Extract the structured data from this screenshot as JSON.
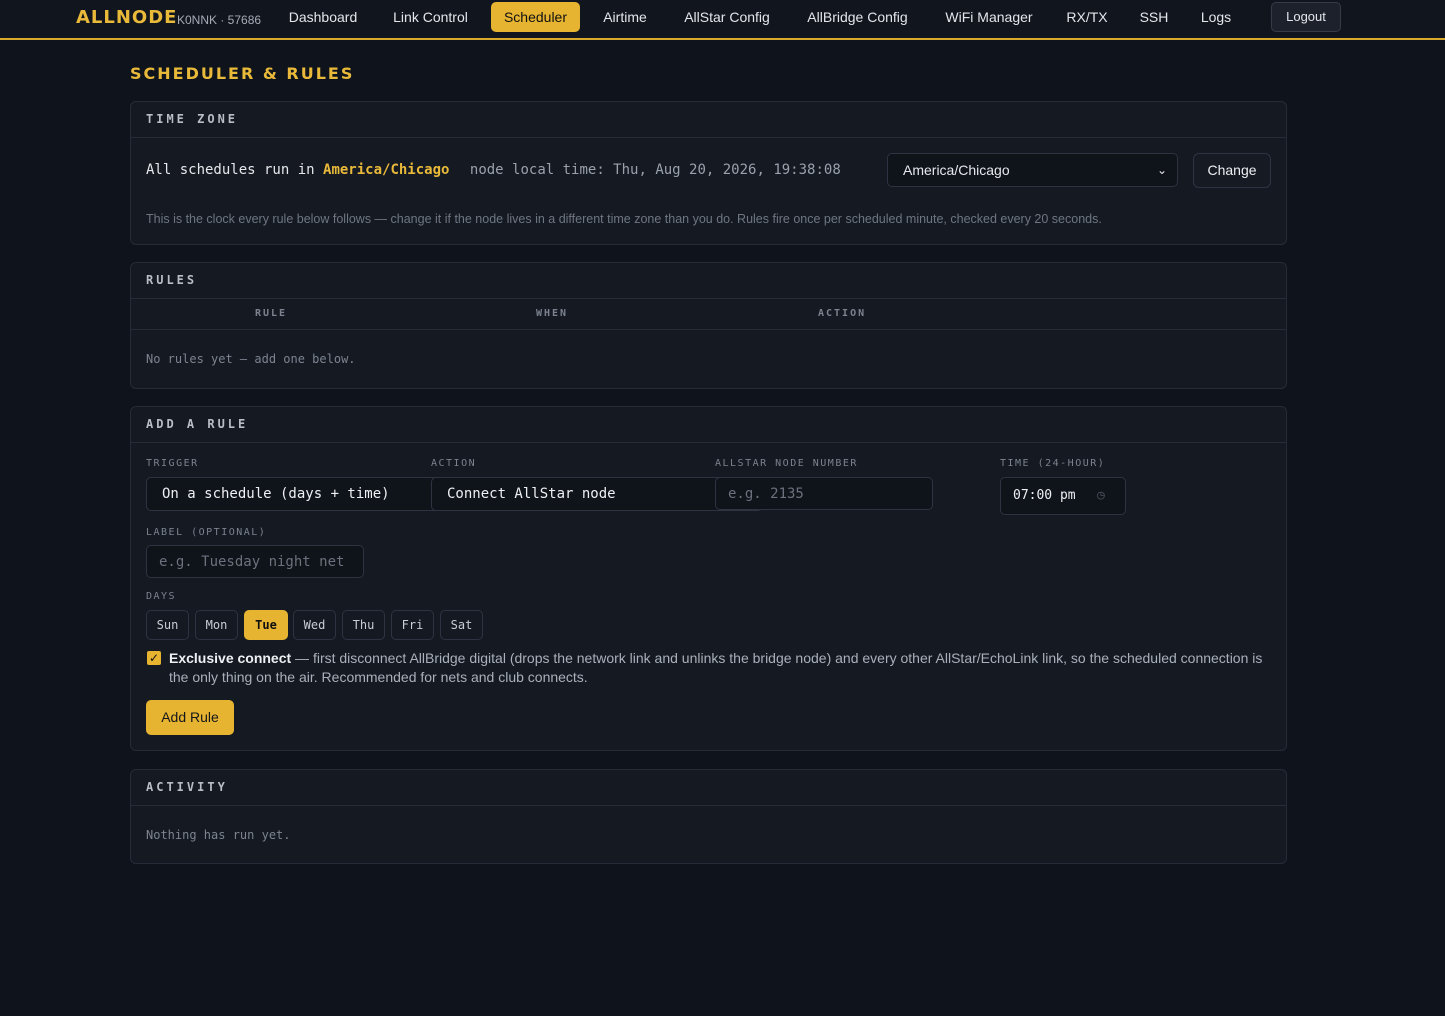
{
  "brand": {
    "name": "ALLNODE",
    "subtitle": "K0NNK · 57686"
  },
  "nav": {
    "items": [
      {
        "label": "Dashboard"
      },
      {
        "label": "Link Control"
      },
      {
        "label": "Scheduler",
        "active": true
      },
      {
        "label": "Airtime"
      },
      {
        "label": "AllStar Config"
      },
      {
        "label": "AllBridge Config"
      },
      {
        "label": "WiFi Manager"
      },
      {
        "label": "RX/TX"
      },
      {
        "label": "SSH"
      },
      {
        "label": "Logs"
      }
    ],
    "logout_label": "Logout"
  },
  "page_title": "SCHEDULER & RULES",
  "timezone": {
    "header": "TIME ZONE",
    "line_prefix": "All schedules run in",
    "city": "America/Chicago",
    "local_time": "node local time: Thu, Aug 20, 2026, 19:38:08",
    "select_value": "America/Chicago",
    "change_label": "Change",
    "hint": "This is the clock every rule below follows — change it if the node lives in a different time zone than you do. Rules fire once per scheduled minute, checked every 20 seconds."
  },
  "rules": {
    "header": "RULES",
    "columns": [
      "RULE",
      "WHEN",
      "ACTION"
    ],
    "empty": "No rules yet — add one below."
  },
  "add_rule": {
    "header": "ADD A RULE",
    "trigger_label": "TRIGGER",
    "trigger_value": "On a schedule (days + time)",
    "action_label": "ACTION",
    "action_value": "Connect AllStar node",
    "node_label": "ALLSTAR NODE NUMBER",
    "node_placeholder": "e.g. 2135",
    "time_label": "TIME (24-HOUR)",
    "time_value": "07:00 pm",
    "label_label": "LABEL (OPTIONAL)",
    "label_placeholder": "e.g. Tuesday night net",
    "days_label": "DAYS",
    "days": [
      {
        "label": "Sun",
        "selected": false
      },
      {
        "label": "Mon",
        "selected": false
      },
      {
        "label": "Tue",
        "selected": true
      },
      {
        "label": "Wed",
        "selected": false
      },
      {
        "label": "Thu",
        "selected": false
      },
      {
        "label": "Fri",
        "selected": false
      },
      {
        "label": "Sat",
        "selected": false
      }
    ],
    "exclusive_checked": true,
    "exclusive_title": "Exclusive connect",
    "exclusive_text": " — first disconnect AllBridge digital (drops the network link and unlinks the bridge node) and every other AllStar/EchoLink link, so the scheduled connection is the only thing on the air. Recommended for nets and club connects.",
    "submit_label": "Add Rule"
  },
  "activity": {
    "header": "ACTIVITY",
    "empty": "Nothing has run yet."
  },
  "colors": {
    "accent": "#e6b431",
    "background": "#0f131b",
    "panel": "#141922",
    "border": "#262c37"
  }
}
